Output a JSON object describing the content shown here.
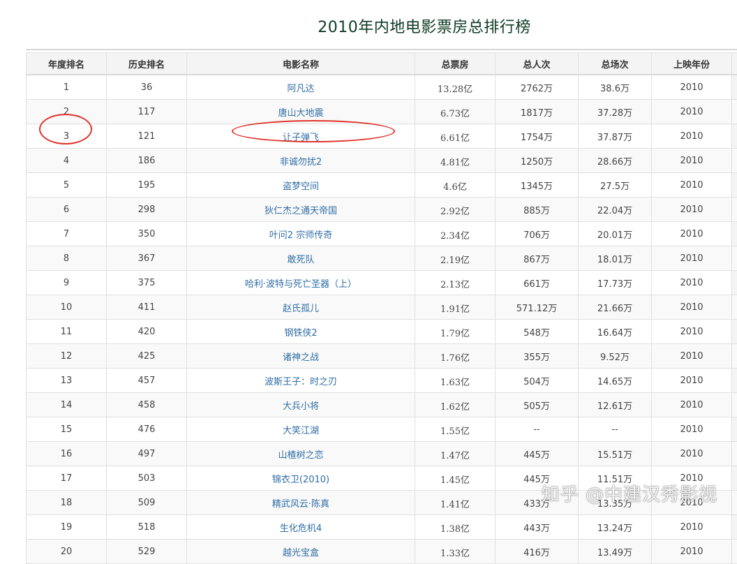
{
  "page": {
    "title": "2010年内地电影票房总排行榜"
  },
  "table": {
    "headers": [
      "年度排名",
      "历史排名",
      "电影名称",
      "总票房",
      "总人次",
      "总场次",
      "上映年份"
    ],
    "rows": [
      {
        "rank": "1",
        "hist": "36",
        "title": "阿凡达",
        "gross": "13.28亿",
        "admissions": "2762万",
        "screenings": "38.6万",
        "year": "2010"
      },
      {
        "rank": "2",
        "hist": "117",
        "title": "唐山大地震",
        "gross": "6.73亿",
        "admissions": "1817万",
        "screenings": "37.28万",
        "year": "2010"
      },
      {
        "rank": "3",
        "hist": "121",
        "title": "让子弹飞",
        "gross": "6.61亿",
        "admissions": "1754万",
        "screenings": "37.87万",
        "year": "2010"
      },
      {
        "rank": "4",
        "hist": "186",
        "title": "非诚勿扰2",
        "gross": "4.81亿",
        "admissions": "1250万",
        "screenings": "28.66万",
        "year": "2010"
      },
      {
        "rank": "5",
        "hist": "195",
        "title": "盗梦空间",
        "gross": "4.6亿",
        "admissions": "1345万",
        "screenings": "27.5万",
        "year": "2010"
      },
      {
        "rank": "6",
        "hist": "298",
        "title": "狄仁杰之通天帝国",
        "gross": "2.92亿",
        "admissions": "885万",
        "screenings": "22.04万",
        "year": "2010"
      },
      {
        "rank": "7",
        "hist": "350",
        "title": "叶问2 宗师传奇",
        "gross": "2.34亿",
        "admissions": "706万",
        "screenings": "20.01万",
        "year": "2010"
      },
      {
        "rank": "8",
        "hist": "367",
        "title": "敢死队",
        "gross": "2.19亿",
        "admissions": "867万",
        "screenings": "18.01万",
        "year": "2010"
      },
      {
        "rank": "9",
        "hist": "375",
        "title": "哈利·波特与死亡圣器（上）",
        "gross": "2.13亿",
        "admissions": "661万",
        "screenings": "17.73万",
        "year": "2010"
      },
      {
        "rank": "10",
        "hist": "411",
        "title": "赵氏孤儿",
        "gross": "1.91亿",
        "admissions": "571.12万",
        "screenings": "21.66万",
        "year": "2010"
      },
      {
        "rank": "11",
        "hist": "420",
        "title": "钢铁侠2",
        "gross": "1.79亿",
        "admissions": "548万",
        "screenings": "16.64万",
        "year": "2010"
      },
      {
        "rank": "12",
        "hist": "425",
        "title": "诸神之战",
        "gross": "1.76亿",
        "admissions": "355万",
        "screenings": "9.52万",
        "year": "2010"
      },
      {
        "rank": "13",
        "hist": "457",
        "title": "波斯王子：时之刃",
        "gross": "1.63亿",
        "admissions": "504万",
        "screenings": "14.65万",
        "year": "2010"
      },
      {
        "rank": "14",
        "hist": "458",
        "title": "大兵小将",
        "gross": "1.62亿",
        "admissions": "505万",
        "screenings": "12.61万",
        "year": "2010"
      },
      {
        "rank": "15",
        "hist": "476",
        "title": "大笑江湖",
        "gross": "1.55亿",
        "admissions": "--",
        "screenings": "--",
        "year": "2010"
      },
      {
        "rank": "16",
        "hist": "497",
        "title": "山楂树之恋",
        "gross": "1.47亿",
        "admissions": "445万",
        "screenings": "15.51万",
        "year": "2010"
      },
      {
        "rank": "17",
        "hist": "503",
        "title": "锦衣卫(2010)",
        "gross": "1.45亿",
        "admissions": "445万",
        "screenings": "11.51万",
        "year": "2010"
      },
      {
        "rank": "18",
        "hist": "509",
        "title": "精武风云·陈真",
        "gross": "1.41亿",
        "admissions": "433万",
        "screenings": "13.35万",
        "year": "2010"
      },
      {
        "rank": "19",
        "hist": "518",
        "title": "生化危机4",
        "gross": "1.38亿",
        "admissions": "443万",
        "screenings": "13.24万",
        "year": "2010"
      },
      {
        "rank": "20",
        "hist": "529",
        "title": "越光宝盒",
        "gross": "1.33亿",
        "admissions": "416万",
        "screenings": "13.49万",
        "year": "2010"
      }
    ]
  },
  "watermark": "知乎 @中建汉秀影视",
  "colors": {
    "title_text": "#0f3b23",
    "link": "#2f6ea5",
    "highlight_circle": "#e0332b"
  }
}
